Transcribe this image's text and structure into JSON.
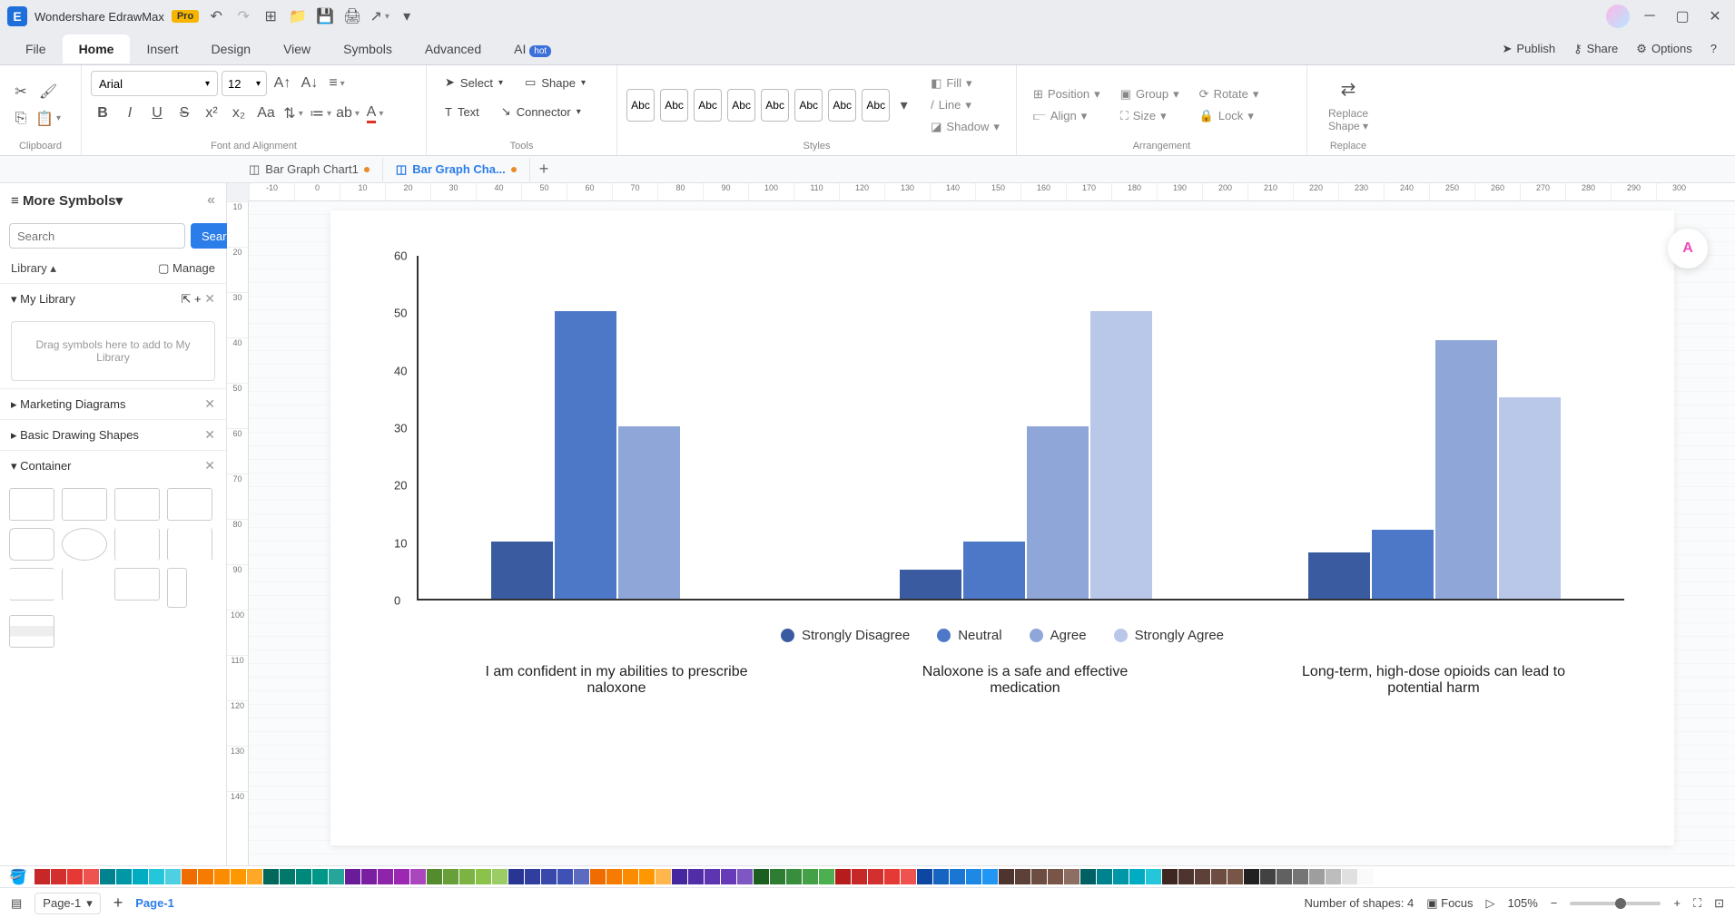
{
  "app": {
    "title": "Wondershare EdrawMax",
    "badge": "Pro"
  },
  "menubar": {
    "tabs": [
      "File",
      "Home",
      "Insert",
      "Design",
      "View",
      "Symbols",
      "Advanced",
      "AI"
    ],
    "active": 1,
    "hot": "hot",
    "right": {
      "publish": "Publish",
      "share": "Share",
      "options": "Options"
    }
  },
  "ribbon": {
    "clipboard": "Clipboard",
    "font_align": "Font and Alignment",
    "tools_label": "Tools",
    "styles_label": "Styles",
    "arrangement_label": "Arrangement",
    "replace_label": "Replace",
    "font": "Arial",
    "size": "12",
    "select": "Select",
    "shape": "Shape",
    "text": "Text",
    "connector": "Connector",
    "styleboxes": [
      "Abc",
      "Abc",
      "Abc",
      "Abc",
      "Abc",
      "Abc",
      "Abc",
      "Abc"
    ],
    "fill": "Fill",
    "line": "Line",
    "shadow": "Shadow",
    "position": "Position",
    "align": "Align",
    "group": "Group",
    "sizebtn": "Size",
    "rotate": "Rotate",
    "lock": "Lock",
    "replace1": "Replace",
    "replace2": "Shape"
  },
  "doctabs": {
    "tabs": [
      {
        "label": "Bar Graph Chart1",
        "active": false,
        "dirty": true
      },
      {
        "label": "Bar Graph Cha...",
        "active": true,
        "dirty": true
      }
    ]
  },
  "sidebar": {
    "title": "More Symbols",
    "search_placeholder": "Search",
    "search_btn": "Search",
    "library": "Library",
    "manage": "Manage",
    "mylib": "My Library",
    "dropzone": "Drag symbols here to add to My Library",
    "sections": [
      "Marketing Diagrams",
      "Basic Drawing Shapes",
      "Container"
    ]
  },
  "ruler": {
    "h": [
      "-10",
      "0",
      "10",
      "20",
      "30",
      "40",
      "50",
      "60",
      "70",
      "80",
      "90",
      "100",
      "110",
      "120",
      "130",
      "140",
      "150",
      "160",
      "170",
      "180",
      "190",
      "200",
      "210",
      "220",
      "230",
      "240",
      "250",
      "260",
      "270",
      "280",
      "290",
      "300"
    ],
    "v": [
      "10",
      "20",
      "30",
      "40",
      "50",
      "60",
      "70",
      "80",
      "90",
      "100",
      "110",
      "120",
      "130",
      "140"
    ]
  },
  "chart_data": {
    "type": "bar",
    "ylim": [
      0,
      60
    ],
    "yticks": [
      0,
      10,
      20,
      30,
      40,
      50,
      60
    ],
    "categories": [
      "I am confident in my abilities to prescribe naloxone",
      "Naloxone is a safe and effective medication",
      "Long-term, high-dose opioids can lead to potential harm"
    ],
    "series": [
      {
        "name": "Strongly Disagree",
        "color": "#3a5ba0",
        "values": [
          10,
          5,
          8
        ]
      },
      {
        "name": "Neutral",
        "color": "#4d78c8",
        "values": [
          50,
          10,
          12
        ]
      },
      {
        "name": "Agree",
        "color": "#8fa6d9",
        "values": [
          30,
          30,
          45
        ]
      },
      {
        "name": "Strongly Agree",
        "color": "#b9c7e8",
        "values": [
          0,
          50,
          35
        ]
      }
    ]
  },
  "colors": [
    "#c62828",
    "#d32f2f",
    "#e53935",
    "#ef5350",
    "#00838f",
    "#0097a7",
    "#00acc1",
    "#26c6da",
    "#4dd0e1",
    "#ef6c00",
    "#f57c00",
    "#fb8c00",
    "#ff9800",
    "#ffa726",
    "#00695c",
    "#00796b",
    "#00897b",
    "#009688",
    "#26a69a",
    "#6a1b9a",
    "#7b1fa2",
    "#8e24aa",
    "#9c27b0",
    "#ab47bc",
    "#558b2f",
    "#689f38",
    "#7cb342",
    "#8bc34a",
    "#9ccc65",
    "#283593",
    "#303f9f",
    "#3949ab",
    "#3f51b5",
    "#5c6bc0",
    "#ef6c00",
    "#f57c00",
    "#fb8c00",
    "#ff9800",
    "#ffb74d",
    "#4527a0",
    "#512da8",
    "#5e35b1",
    "#673ab7",
    "#7e57c2",
    "#1b5e20",
    "#2e7d32",
    "#388e3c",
    "#43a047",
    "#4caf50",
    "#b71c1c",
    "#c62828",
    "#d32f2f",
    "#e53935",
    "#ef5350",
    "#0d47a1",
    "#1565c0",
    "#1976d2",
    "#1e88e5",
    "#2196f3",
    "#4e342e",
    "#5d4037",
    "#6d4c41",
    "#795548",
    "#8d6e63",
    "#006064",
    "#00838f",
    "#0097a7",
    "#00acc1",
    "#26c6da",
    "#3e2723",
    "#4e342e",
    "#5d4037",
    "#6d4c41",
    "#795548",
    "#212121",
    "#424242",
    "#616161",
    "#757575",
    "#9e9e9e",
    "#bdbdbd",
    "#e0e0e0",
    "#fafafa"
  ],
  "status": {
    "page_sel": "Page-1",
    "page_label": "Page-1",
    "shapes": "Number of shapes: 4",
    "focus": "Focus",
    "zoom": "105%"
  }
}
